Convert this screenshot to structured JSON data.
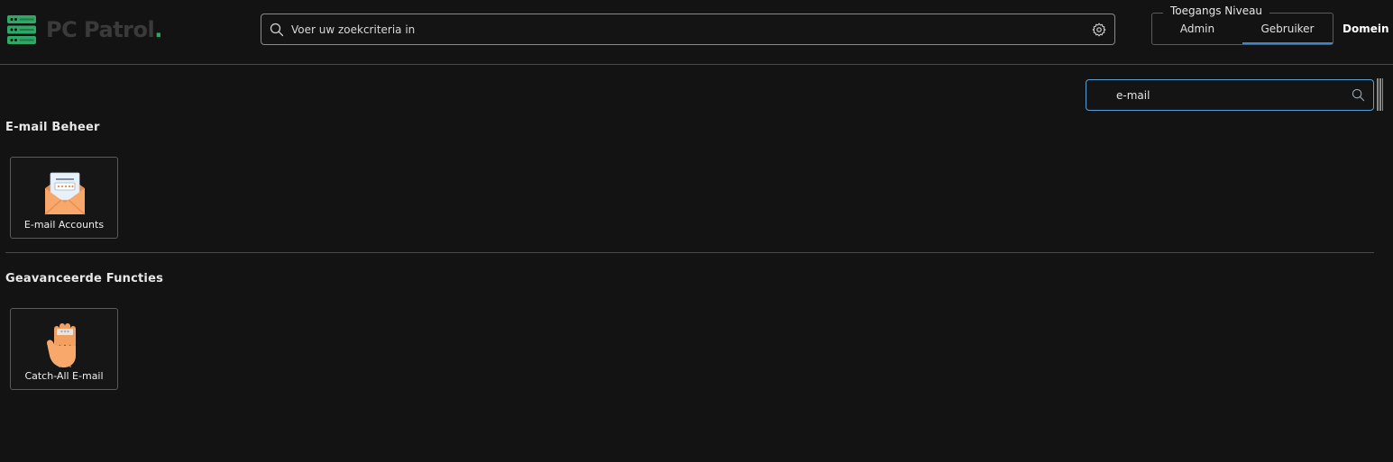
{
  "brand": {
    "name": "PC Patrol",
    "dot": ".",
    "logo_icon": "server-stack-icon",
    "accent_color": "#2fa866"
  },
  "header": {
    "search": {
      "placeholder": "Voer uw zoekcriteria in",
      "value": ""
    },
    "access_level": {
      "legend": "Toegangs Niveau",
      "options": [
        "Admin",
        "Gebruiker"
      ],
      "selected": "Gebruiker"
    },
    "domain_label": "Domein"
  },
  "filter": {
    "value": "e-mail"
  },
  "sections": [
    {
      "title": "E-mail Beheer",
      "tiles": [
        {
          "label": "E-mail Accounts",
          "icon": "envelope-password-icon"
        }
      ]
    },
    {
      "title": "Geavanceerde Functies",
      "tiles": [
        {
          "label": "Catch-All E-mail",
          "icon": "raised-hand-icon"
        }
      ]
    }
  ],
  "colors": {
    "background": "#131313",
    "active_tab_underline": "#3f87c6",
    "focus_border": "#5a9fd4",
    "envelope": "#f7a86a"
  }
}
